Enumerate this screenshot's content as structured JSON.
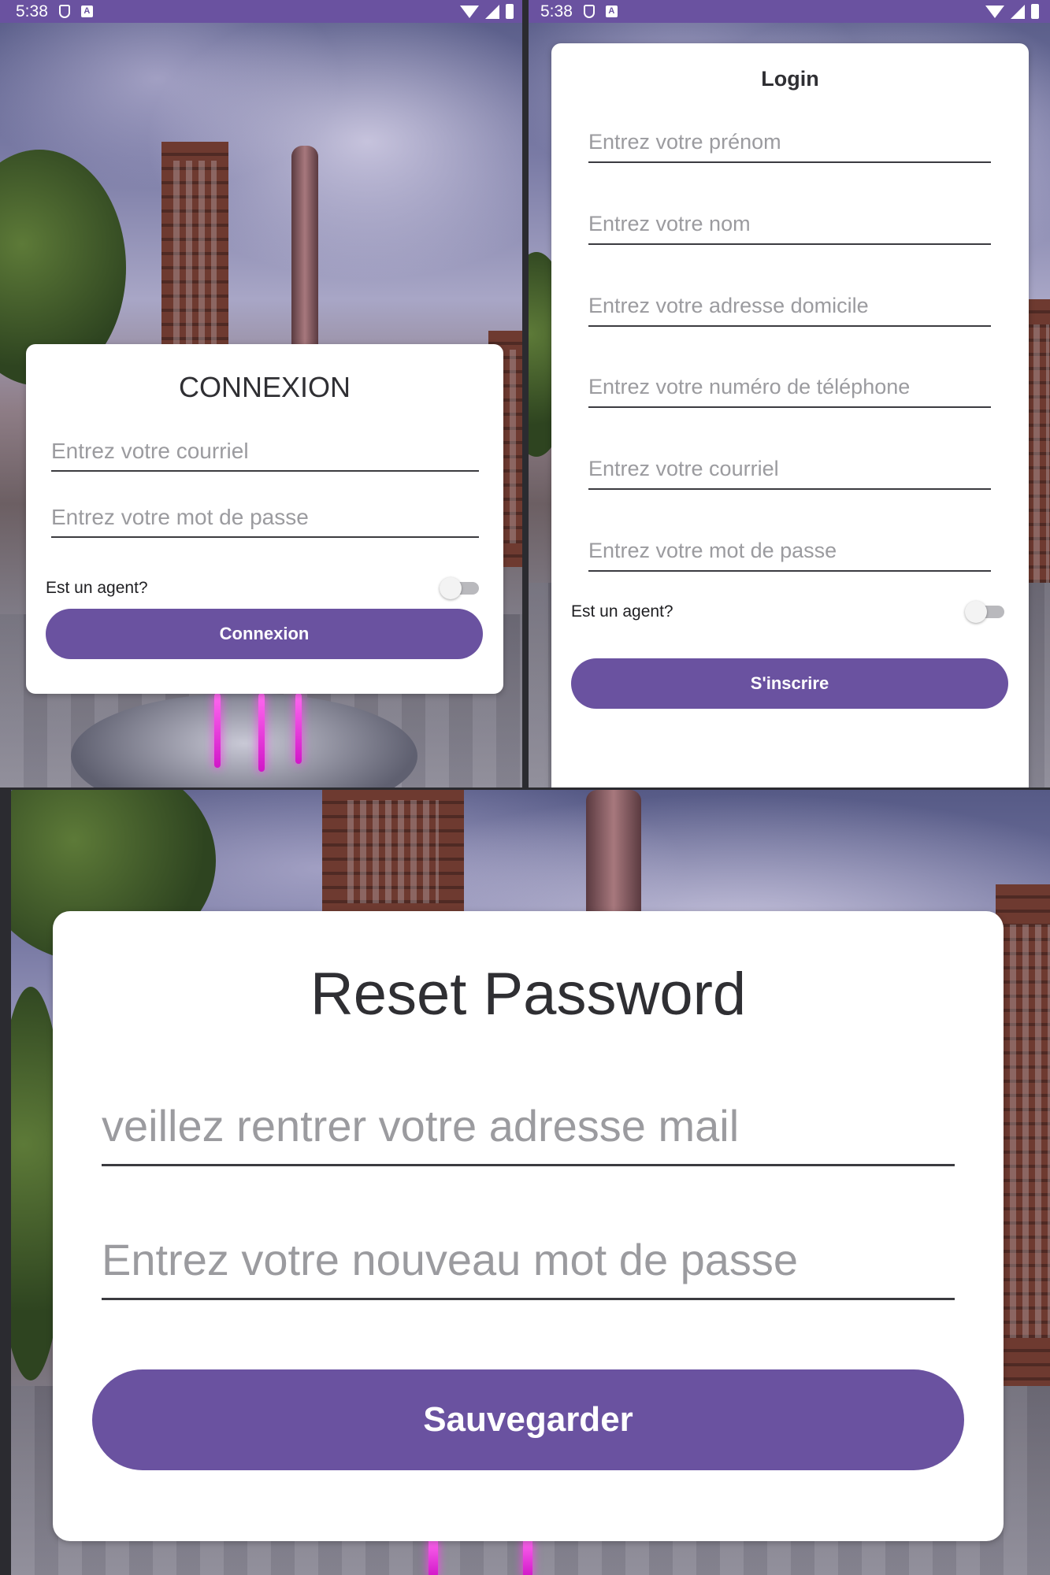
{
  "status_bar": {
    "time": "5:38"
  },
  "connexion_screen": {
    "title": "CONNEXION",
    "email_placeholder": "Entrez votre courriel",
    "password_placeholder": "Entrez votre mot de passe",
    "agent_label": "Est un agent?",
    "agent_toggle_on": false,
    "submit_label": "Connexion"
  },
  "register_screen": {
    "title": "Login",
    "firstname_placeholder": "Entrez votre prénom",
    "lastname_placeholder": "Entrez votre nom",
    "address_placeholder": "Entrez votre adresse domicile",
    "phone_placeholder": "Entrez votre numéro de téléphone",
    "email_placeholder": "Entrez votre courriel",
    "password_placeholder": "Entrez votre mot de passe",
    "agent_label": "Est un agent?",
    "agent_toggle_on": false,
    "submit_label": "S'inscrire"
  },
  "reset_screen": {
    "title": "Reset Password",
    "email_placeholder": "veillez rentrer votre adresse mail",
    "new_password_placeholder": "Entrez votre nouveau mot de passe",
    "submit_label": "Sauvegarder"
  },
  "colors": {
    "accent": "#6a52a0",
    "card": "#ffffff",
    "placeholder_text": "#9b9b9f"
  }
}
